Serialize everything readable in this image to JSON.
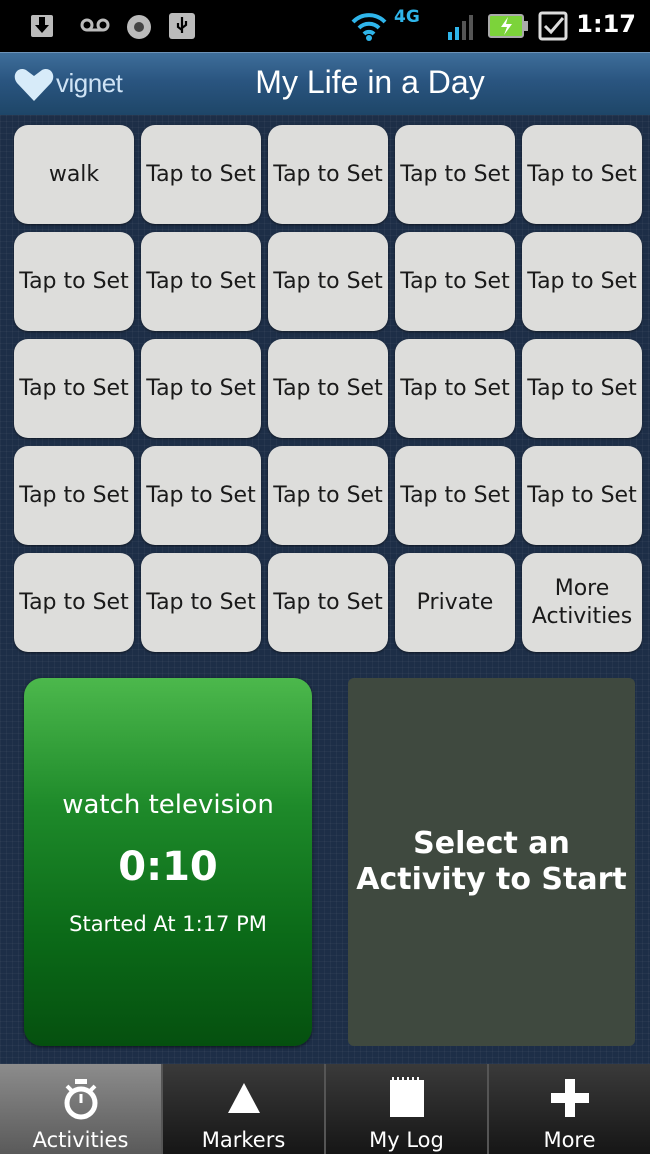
{
  "status_bar": {
    "time": "1:17",
    "icons": [
      "download-icon",
      "voicemail-icon",
      "circle-notification-icon",
      "usb-icon",
      "wifi-icon",
      "4g-lte-icon",
      "signal-icon",
      "battery-charging-icon",
      "checkbox-notification-icon"
    ],
    "network_label": "4G"
  },
  "header": {
    "logo_text": "vignet",
    "title": "My Life in a Day"
  },
  "tiles": [
    "walk",
    "Tap to Set",
    "Tap to Set",
    "Tap to Set",
    "Tap to Set",
    "Tap to Set",
    "Tap to Set",
    "Tap to Set",
    "Tap to Set",
    "Tap to Set",
    "Tap to Set",
    "Tap to Set",
    "Tap to Set",
    "Tap to Set",
    "Tap to Set",
    "Tap to Set",
    "Tap to Set",
    "Tap to Set",
    "Tap to Set",
    "Tap to Set",
    "Tap to Set",
    "Tap to Set",
    "Tap to Set",
    "Private",
    "More Activities"
  ],
  "current_activity": {
    "name": "watch television",
    "timer": "0:10",
    "started": "Started At 1:17 PM"
  },
  "next_activity": {
    "label": "Select an Activity to Start"
  },
  "tabs": [
    {
      "label": "Activities",
      "icon": "stopwatch-icon",
      "active": true
    },
    {
      "label": "Markers",
      "icon": "triangle-icon",
      "active": false
    },
    {
      "label": "My Log",
      "icon": "notepad-icon",
      "active": false
    },
    {
      "label": "More",
      "icon": "plus-icon",
      "active": false
    }
  ],
  "colors": {
    "accent_green": "#1e8a2a",
    "header_blue": "#2a5580",
    "tile_gray": "#dddddb"
  }
}
